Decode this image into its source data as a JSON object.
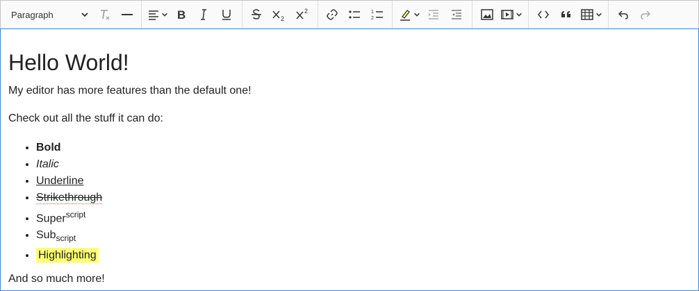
{
  "toolbar": {
    "paragraph_label": "Paragraph",
    "icons": [
      "remove-format-icon",
      "horizontal-line-icon",
      "align-icon",
      "bold-icon",
      "italic-icon",
      "underline-icon",
      "strikethrough-icon",
      "subscript-icon",
      "superscript-icon",
      "link-icon",
      "bulleted-list-icon",
      "numbered-list-icon",
      "highlight-icon",
      "outdent-icon",
      "indent-icon",
      "image-icon",
      "media-icon",
      "code-icon",
      "blockquote-icon",
      "table-icon",
      "undo-icon",
      "redo-icon"
    ]
  },
  "content": {
    "heading": "Hello World!",
    "intro": "My editor has more features than the default one!",
    "lead": "Check out all the stuff it can do:",
    "list": {
      "bold": "Bold",
      "italic": "Italic",
      "underline": "Underline",
      "strikethrough": "Strikethrough",
      "super_base": "Super",
      "super_text": "script",
      "sub_base": "Sub",
      "sub_text": "script",
      "highlighting": "Highlighting"
    },
    "closing": "And so much more!"
  },
  "colors": {
    "focus_border": "#3c86cf",
    "highlight": "#fdfd77",
    "toolbar_bg": "#fafafa"
  }
}
